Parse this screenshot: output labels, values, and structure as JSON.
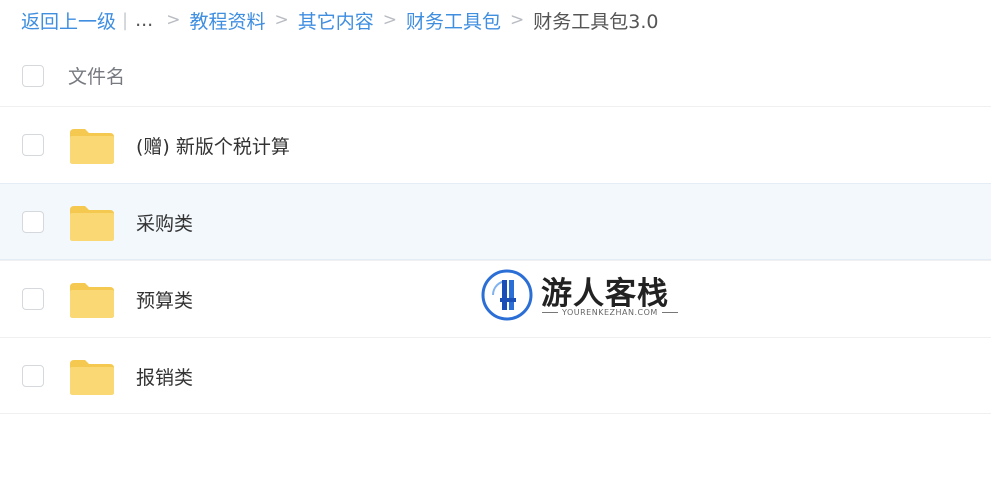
{
  "breadcrumb": {
    "back": "返回上一级",
    "separator": "|",
    "ellipsis": "...",
    "chevron": ">",
    "items": [
      "教程资料",
      "其它内容",
      "财务工具包"
    ],
    "current": "财务工具包3.0"
  },
  "header": {
    "column_label": "文件名"
  },
  "files": [
    {
      "name": "(赠) 新版个税计算",
      "type": "folder"
    },
    {
      "name": "采购类",
      "type": "folder"
    },
    {
      "name": "预算类",
      "type": "folder"
    },
    {
      "name": "报销类",
      "type": "folder"
    }
  ],
  "watermark": {
    "title": "游人客栈",
    "subtitle": "YOURENKEZHAN.COM"
  },
  "colors": {
    "link": "#3f8ee0",
    "folder": "#f9d56e",
    "folder_tab": "#f5c84f",
    "row_hover": "#f3f8fd"
  }
}
